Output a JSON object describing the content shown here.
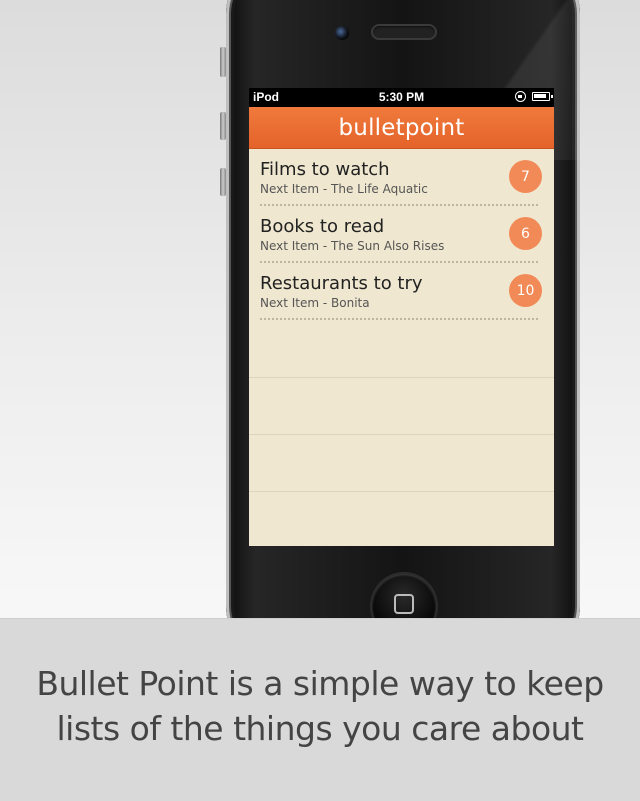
{
  "status_bar": {
    "carrier": "iPod",
    "time": "5:30 PM",
    "icons": [
      "orientation-lock-icon",
      "battery-icon"
    ]
  },
  "app": {
    "title": "bulletpoint",
    "accent_color": "#e96c30",
    "badge_color": "#f28a57"
  },
  "lists": [
    {
      "title": "Films to watch",
      "subtitle": "Next Item - The Life Aquatic",
      "count": "7"
    },
    {
      "title": "Books to read",
      "subtitle": "Next Item - The Sun Also Rises",
      "count": "6"
    },
    {
      "title": "Restaurants to try",
      "subtitle": "Next Item - Bonita",
      "count": "10"
    }
  ],
  "caption": {
    "line1": "Bullet Point is a simple way to keep",
    "line2": "lists of the things you care about"
  }
}
